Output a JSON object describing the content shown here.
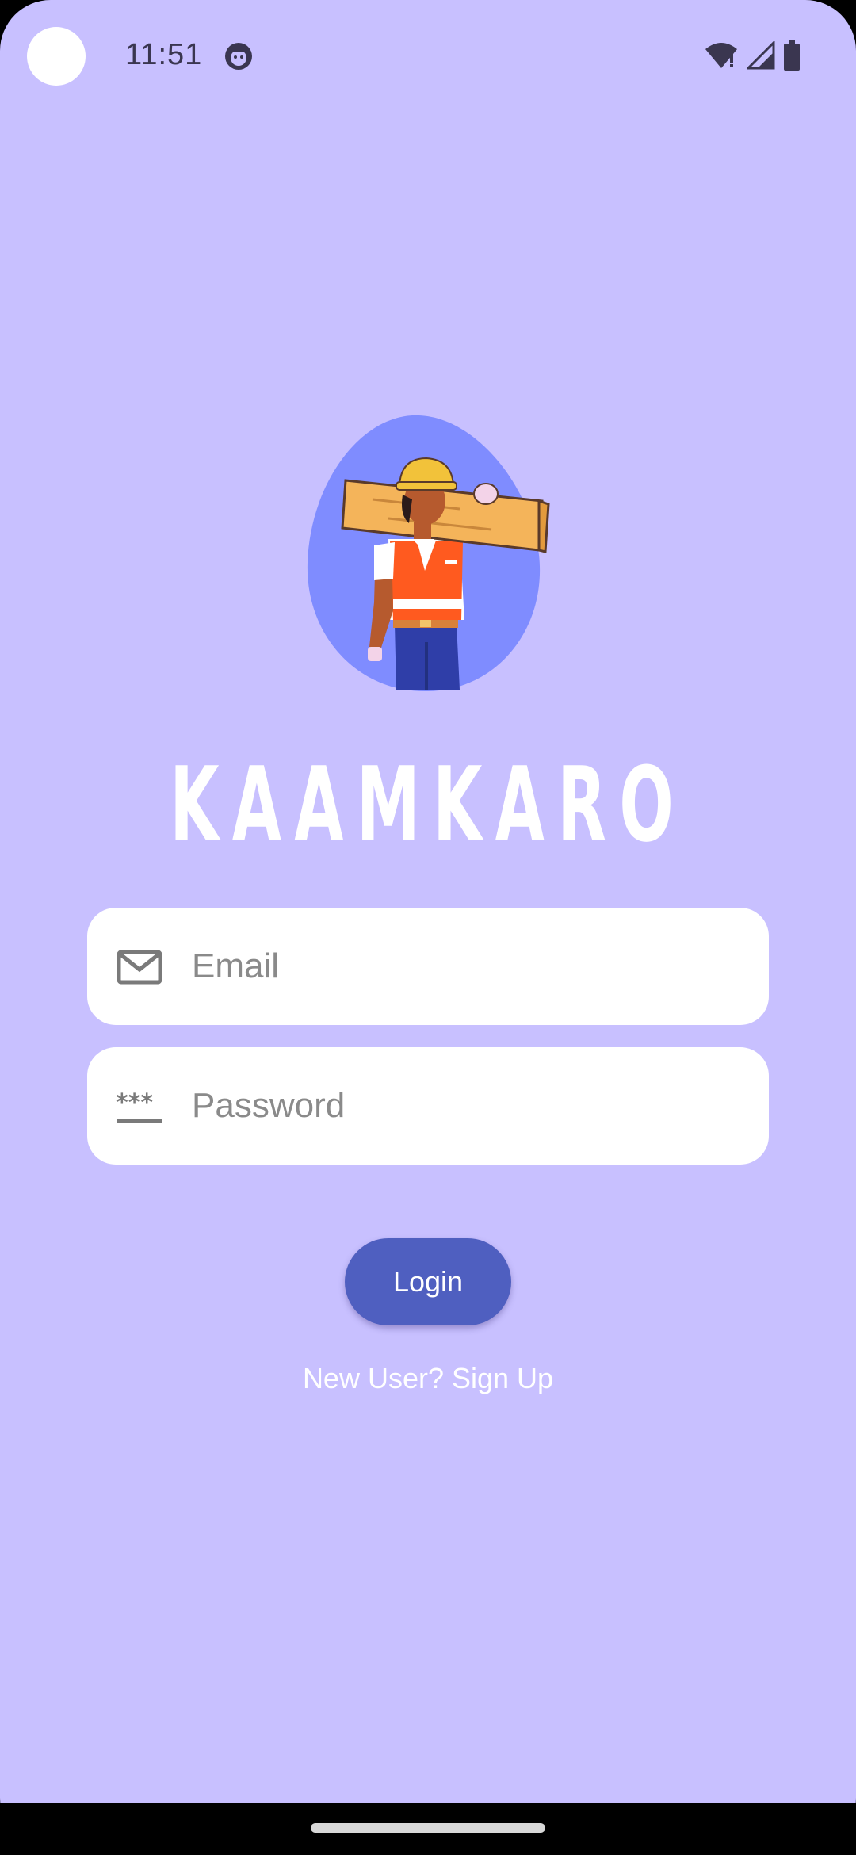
{
  "status_bar": {
    "time": "11:51",
    "app_icon": "android-face-icon",
    "icons": [
      "wifi-alert-icon",
      "signal-icon",
      "battery-icon"
    ]
  },
  "app": {
    "title": "KAAMKARO",
    "illustration": "construction-worker-illustration"
  },
  "form": {
    "email": {
      "icon": "mail-icon",
      "placeholder": "Email",
      "value": ""
    },
    "password": {
      "icon": "password-icon",
      "placeholder": "Password",
      "value": ""
    },
    "login_label": "Login",
    "signup_label": "New User? Sign Up"
  },
  "colors": {
    "background": "#c8c0ff",
    "accent": "#4f5fc0",
    "blob": "#7f8cff"
  }
}
